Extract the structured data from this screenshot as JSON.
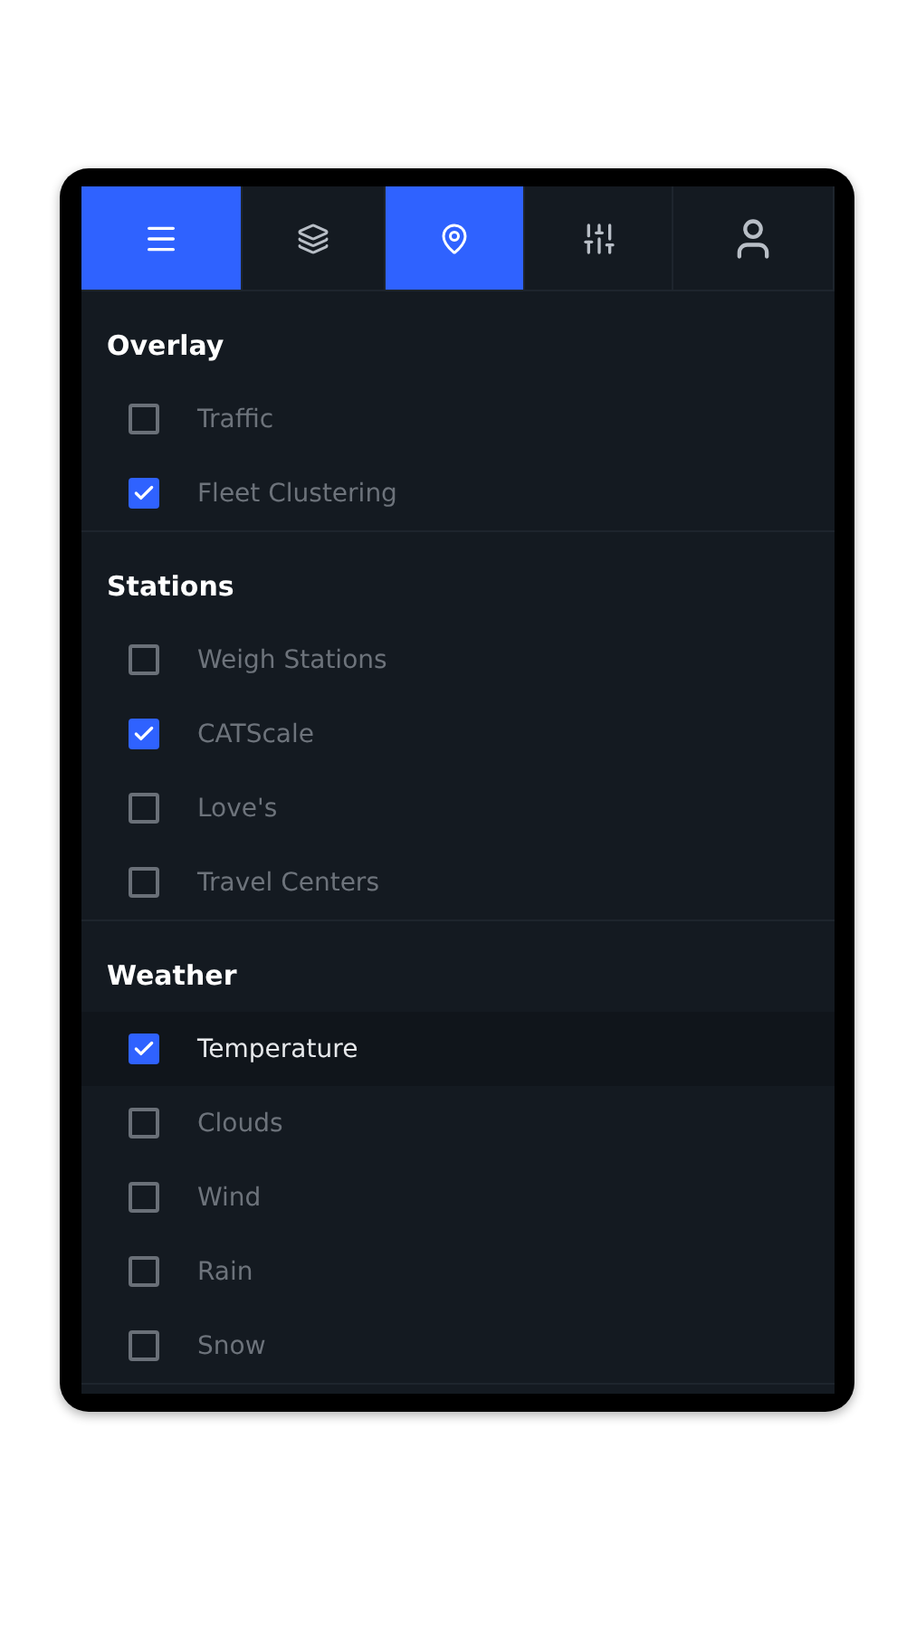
{
  "tabs": [
    {
      "selected": true
    },
    {
      "selected": false
    },
    {
      "selected": true
    },
    {
      "selected": false
    },
    {
      "selected": false
    }
  ],
  "sections": [
    {
      "title": "Overlay",
      "items": [
        {
          "label": "Traffic",
          "checked": false,
          "highlighted": false
        },
        {
          "label": "Fleet Clustering",
          "checked": true,
          "highlighted": false
        }
      ]
    },
    {
      "title": "Stations",
      "items": [
        {
          "label": "Weigh Stations",
          "checked": false,
          "highlighted": false
        },
        {
          "label": "CATScale",
          "checked": true,
          "highlighted": false
        },
        {
          "label": "Love's",
          "checked": false,
          "highlighted": false
        },
        {
          "label": "Travel Centers",
          "checked": false,
          "highlighted": false
        }
      ]
    },
    {
      "title": "Weather",
      "items": [
        {
          "label": "Temperature",
          "checked": true,
          "highlighted": true
        },
        {
          "label": "Clouds",
          "checked": false,
          "highlighted": false
        },
        {
          "label": "Wind",
          "checked": false,
          "highlighted": false
        },
        {
          "label": "Rain",
          "checked": false,
          "highlighted": false
        },
        {
          "label": "Snow",
          "checked": false,
          "highlighted": false
        }
      ]
    }
  ]
}
